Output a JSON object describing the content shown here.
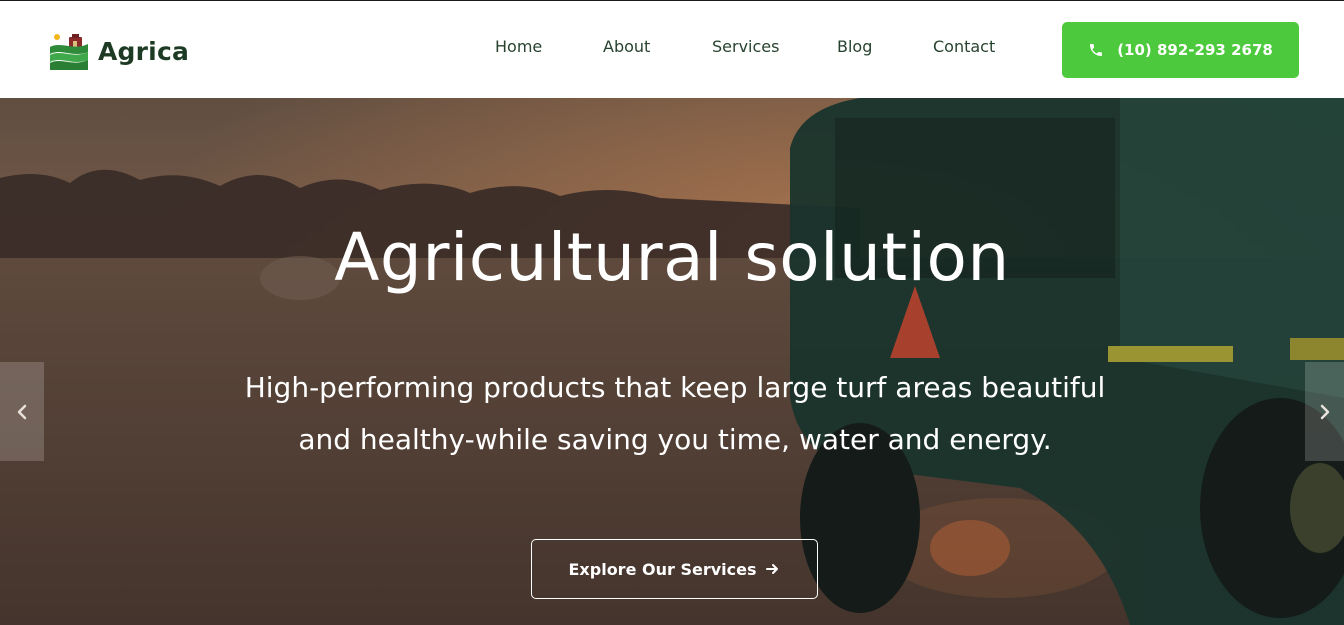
{
  "brand": {
    "name": "Agrica",
    "logo_icon": "farm-field-sun-icon"
  },
  "nav": {
    "items": [
      {
        "label": "Home"
      },
      {
        "label": "About"
      },
      {
        "label": "Services"
      },
      {
        "label": "Blog"
      },
      {
        "label": "Contact"
      }
    ]
  },
  "call": {
    "label": "(10) 892-293 2678",
    "icon": "phone-icon"
  },
  "hero": {
    "title": "Agricultural solution",
    "subtitle": "High-performing products that keep large turf areas beautiful and healthy-while saving you time, water and energy.",
    "cta_label": "Explore Our Services",
    "cta_icon": "arrow-right-icon",
    "prev_icon": "chevron-left-icon",
    "next_icon": "chevron-right-icon"
  },
  "colors": {
    "accent": "#4cc93c",
    "brand_dark": "#1d3b24",
    "nav_text": "#27432f",
    "hero_overlay": "#5e4a3b"
  }
}
